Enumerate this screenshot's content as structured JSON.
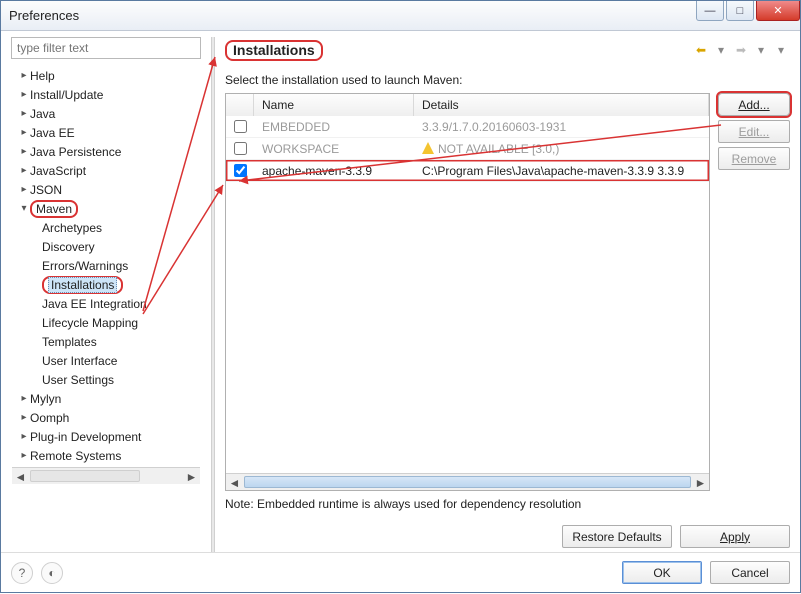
{
  "window": {
    "title": "Preferences"
  },
  "filter": {
    "placeholder": "type filter text"
  },
  "tree": {
    "top": [
      {
        "label": "Help",
        "expandable": true
      },
      {
        "label": "Install/Update",
        "expandable": true
      },
      {
        "label": "Java",
        "expandable": true
      },
      {
        "label": "Java EE",
        "expandable": true
      },
      {
        "label": "Java Persistence",
        "expandable": true
      },
      {
        "label": "JavaScript",
        "expandable": true
      },
      {
        "label": "JSON",
        "expandable": true
      }
    ],
    "maven": {
      "label": "Maven",
      "children": [
        "Archetypes",
        "Discovery",
        "Errors/Warnings",
        "Installations",
        "Java EE Integration",
        "Lifecycle Mapping",
        "Templates",
        "User Interface",
        "User Settings"
      ],
      "selectedChild": "Installations"
    },
    "bottom": [
      {
        "label": "Mylyn",
        "expandable": true
      },
      {
        "label": "Oomph",
        "expandable": true
      },
      {
        "label": "Plug-in Development",
        "expandable": true
      },
      {
        "label": "Remote Systems",
        "expandable": true
      }
    ]
  },
  "page": {
    "title": "Installations",
    "description": "Select the installation used to launch Maven:",
    "columns": {
      "check": "",
      "name": "Name",
      "details": "Details"
    },
    "rows": [
      {
        "checked": false,
        "name": "EMBEDDED",
        "details": "3.3.9/1.7.0.20160603-1931",
        "state": "disabled"
      },
      {
        "checked": false,
        "name": "WORKSPACE",
        "details": "NOT AVAILABLE [3.0,)",
        "state": "disabled",
        "warn": true
      },
      {
        "checked": true,
        "name": "apache-maven-3.3.9",
        "details": "C:\\Program Files\\Java\\apache-maven-3.3.9 3.3.9",
        "state": "selected"
      }
    ],
    "sideButtons": {
      "add": "Add...",
      "edit": "Edit...",
      "remove": "Remove"
    },
    "note": "Note: Embedded runtime is always used for dependency resolution",
    "restore": "Restore Defaults",
    "apply": "Apply"
  },
  "footer": {
    "ok": "OK",
    "cancel": "Cancel"
  }
}
